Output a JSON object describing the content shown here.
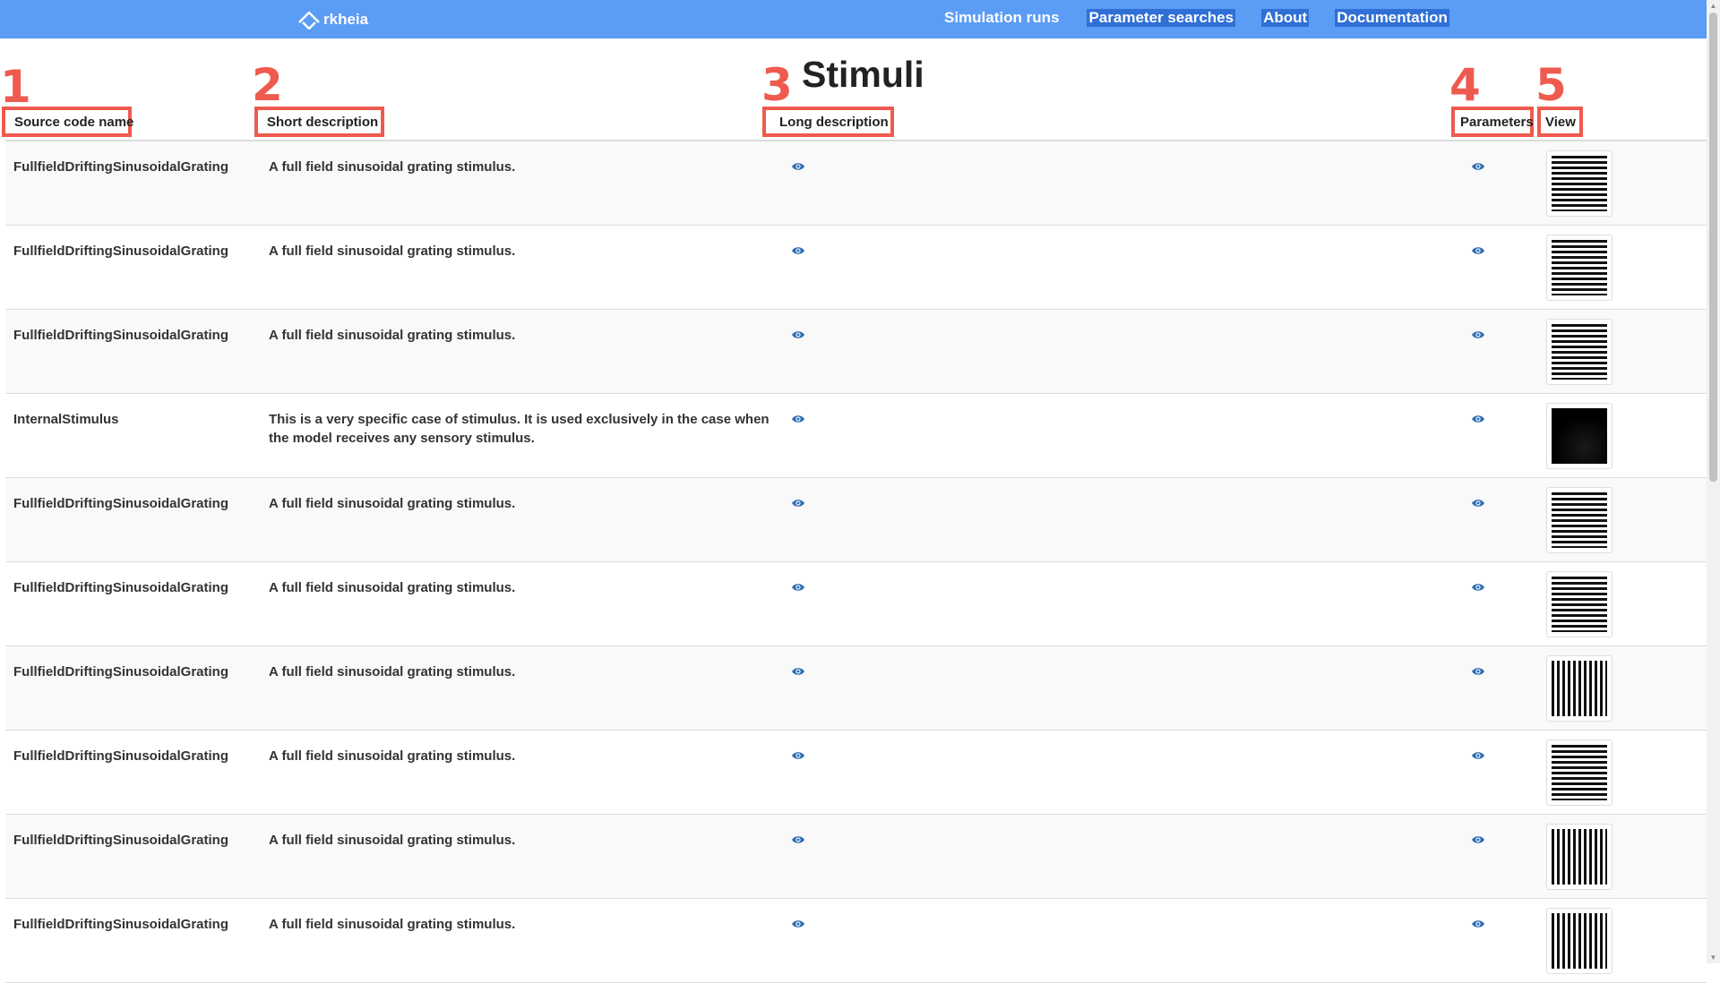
{
  "nav": {
    "logo_text": "rkheia",
    "links": [
      "Simulation runs",
      "Parameter searches",
      "About",
      "Documentation"
    ]
  },
  "page": {
    "title": "Stimuli"
  },
  "markers": [
    "1",
    "2",
    "3",
    "4",
    "5"
  ],
  "columns": {
    "source_code_name": "Source code name",
    "short_description": "Short description",
    "long_description": "Long description",
    "parameters": "Parameters",
    "view": "View"
  },
  "rows": [
    {
      "name": "FullfieldDriftingSinusoidalGrating",
      "short": "A full field sinusoidal grating stimulus.",
      "view": "horizontal-grating"
    },
    {
      "name": "FullfieldDriftingSinusoidalGrating",
      "short": "A full field sinusoidal grating stimulus.",
      "view": "horizontal-grating"
    },
    {
      "name": "FullfieldDriftingSinusoidalGrating",
      "short": "A full field sinusoidal grating stimulus.",
      "view": "horizontal-grating"
    },
    {
      "name": "InternalStimulus",
      "short": "This is a very specific case of stimulus. It is used exclusively in the case when the model receives any sensory stimulus.",
      "view": "black"
    },
    {
      "name": "FullfieldDriftingSinusoidalGrating",
      "short": "A full field sinusoidal grating stimulus.",
      "view": "horizontal-grating"
    },
    {
      "name": "FullfieldDriftingSinusoidalGrating",
      "short": "A full field sinusoidal grating stimulus.",
      "view": "horizontal-grating"
    },
    {
      "name": "FullfieldDriftingSinusoidalGrating",
      "short": "A full field sinusoidal grating stimulus.",
      "view": "vertical-grating"
    },
    {
      "name": "FullfieldDriftingSinusoidalGrating",
      "short": "A full field sinusoidal grating stimulus.",
      "view": "horizontal-grating"
    },
    {
      "name": "FullfieldDriftingSinusoidalGrating",
      "short": "A full field sinusoidal grating stimulus.",
      "view": "vertical-grating"
    },
    {
      "name": "FullfieldDriftingSinusoidalGrating",
      "short": "A full field sinusoidal grating stimulus.",
      "view": "vertical-grating"
    }
  ],
  "colors": {
    "navbar": "#5b9cf5",
    "marker": "#ef5a4f",
    "eye_icon": "#2e6db4"
  },
  "icons": {
    "long_description": "eye-icon",
    "parameters": "eye-icon"
  }
}
